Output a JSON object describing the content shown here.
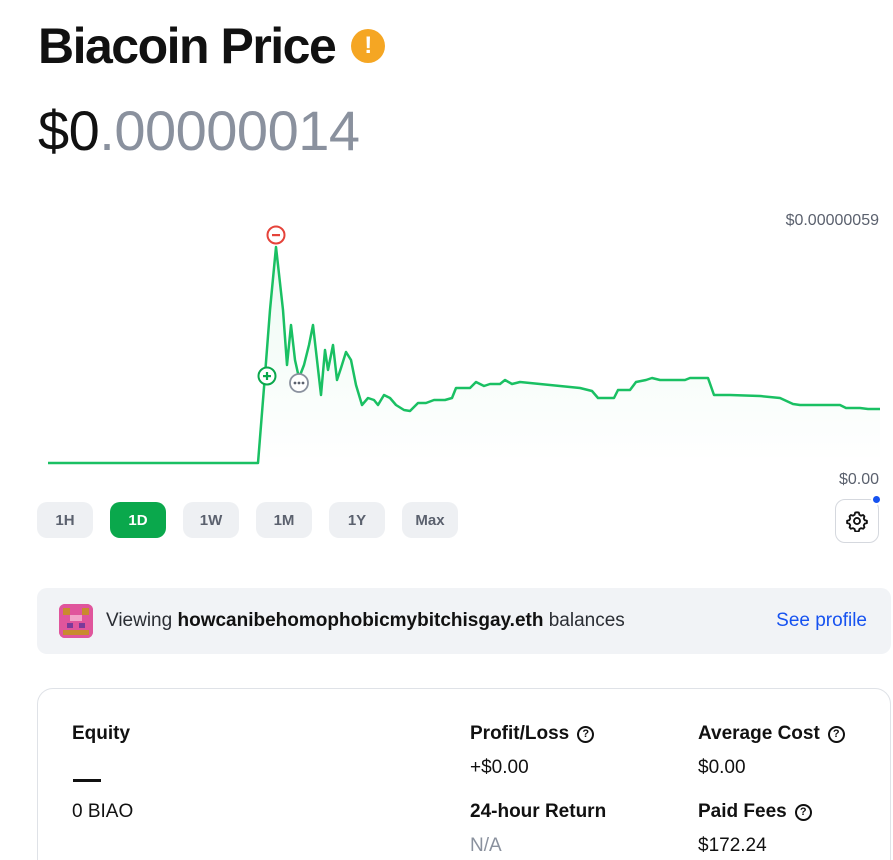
{
  "header": {
    "title": "Biacoin Price",
    "warning_icon": "exclamation-icon",
    "warning_color": "#f5a623"
  },
  "price": {
    "main": "$0",
    "fraction": ".00000014"
  },
  "chart": {
    "max_label": "$0.00000059",
    "min_label": "$0.00",
    "line_color": "#1ac063",
    "sell_marker_icon": "minus-circle-icon",
    "buy_marker_icon": "plus-circle-icon",
    "more_marker_icon": "ellipsis-circle-icon"
  },
  "ranges": [
    {
      "label": "1H",
      "active": false
    },
    {
      "label": "1D",
      "active": true
    },
    {
      "label": "1W",
      "active": false
    },
    {
      "label": "1M",
      "active": false
    },
    {
      "label": "1Y",
      "active": false
    },
    {
      "label": "Max",
      "active": false
    }
  ],
  "settings": {
    "icon": "gear-icon",
    "notification_color": "#1652f0"
  },
  "viewing": {
    "prefix": "Viewing",
    "ens": "howcanibehomophobicmybitchisgay.eth",
    "suffix": "balances",
    "link": "See profile"
  },
  "holdings": {
    "equity_label": "Equity",
    "equity_value": "—",
    "balance": "0 BIAO",
    "pnl_label": "Profit/Loss",
    "pnl_value": "+$0.00",
    "return_label": "24-hour Return",
    "return_value": "N/A",
    "avg_cost_label": "Average Cost",
    "avg_cost_value": "$0.00",
    "fees_label": "Paid Fees",
    "fees_value": "$172.24"
  }
}
